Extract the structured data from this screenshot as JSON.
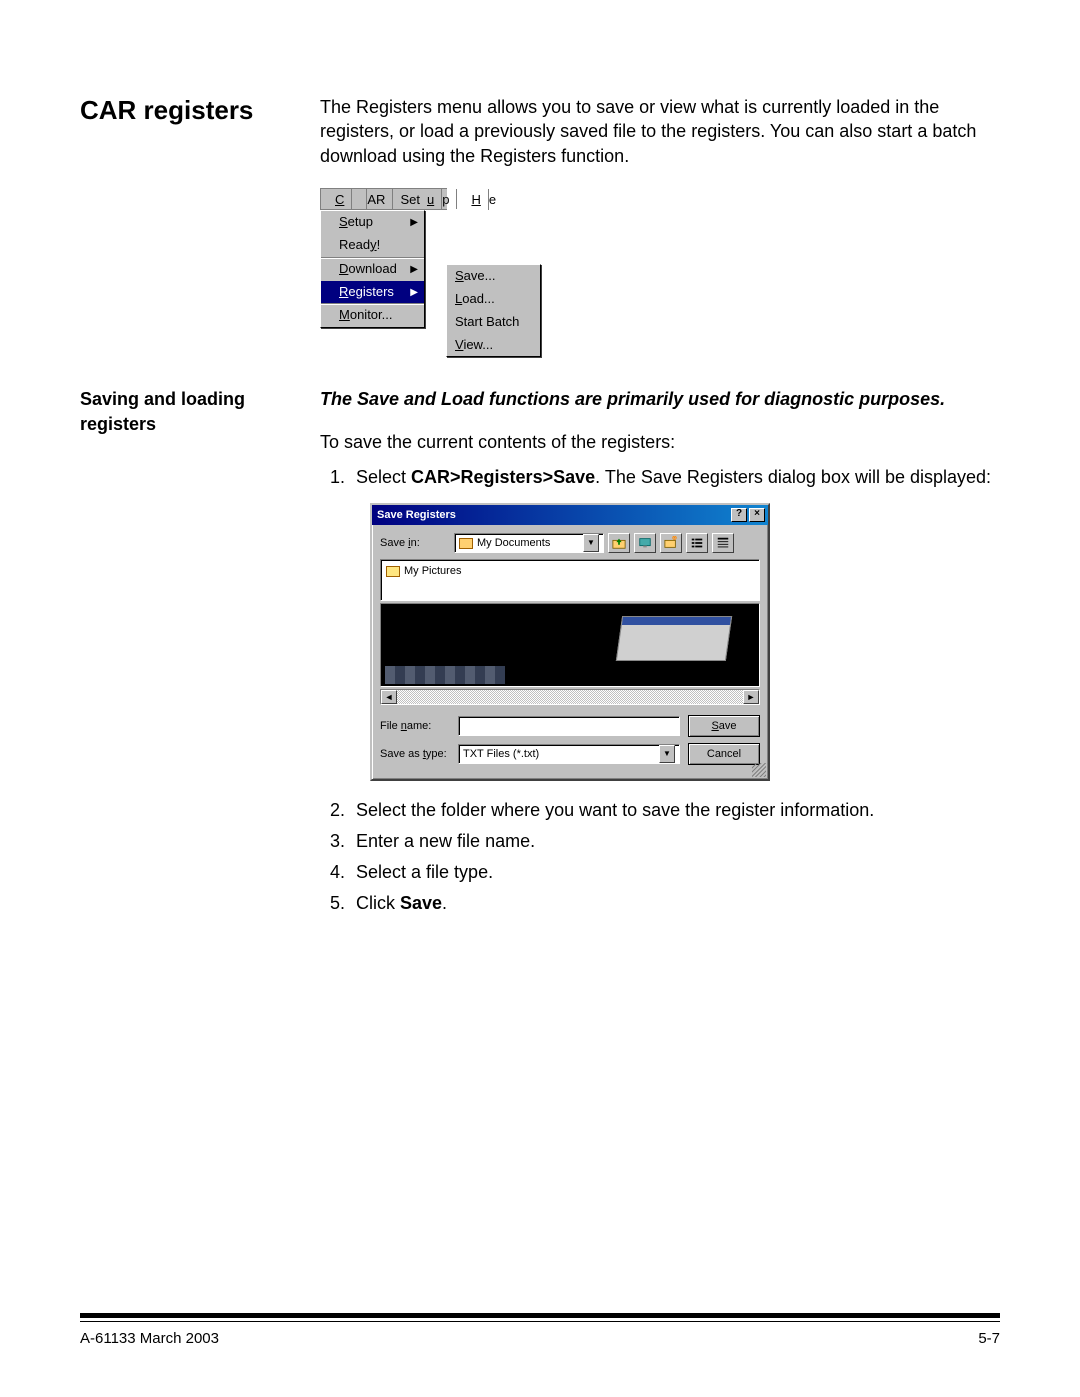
{
  "section_title": "CAR registers",
  "intro_text": "The Registers menu allows you to save or view what is currently loaded in the registers, or load a previously saved file to the registers. You can also start a batch download using the Registers function.",
  "menu": {
    "menubar": [
      "CAR",
      "Setup",
      "He"
    ],
    "dropdown": [
      {
        "label": "Setup",
        "arrow": true
      },
      {
        "label": "Ready!",
        "arrow": false
      },
      {
        "label": "Download",
        "arrow": true
      },
      {
        "label": "Registers",
        "arrow": true,
        "selected": true
      },
      {
        "label": "Monitor...",
        "arrow": false
      }
    ],
    "submenu": [
      "Save...",
      "Load...",
      "Start Batch",
      "View..."
    ]
  },
  "sub_heading": "Saving and loading registers",
  "italic_note": "The Save and Load functions are primarily used for diagnostic purposes.",
  "body_intro": "To save the current contents of the registers:",
  "step1_prefix": "Select ",
  "step1_bold": "CAR>Registers>Save",
  "step1_suffix": ".  The Save Registers dialog box will be displayed:",
  "dialog": {
    "title": "Save Registers",
    "save_in_label": "Save in:",
    "save_in_value": "My Documents",
    "file_list_item": "My Pictures",
    "filename_label": "File name:",
    "filename_value": "",
    "saveastype_label": "Save as type:",
    "saveastype_value": "TXT Files  (*.txt)",
    "save_btn": "Save",
    "cancel_btn": "Cancel",
    "toolbar_icons": [
      "up-folder-icon",
      "desktop-icon",
      "new-folder-icon",
      "list-view-icon",
      "details-view-icon"
    ]
  },
  "steps_rest": [
    "Select the folder where you want to save the register information.",
    "Enter a new file name.",
    "Select a file type."
  ],
  "step5_prefix": "Click ",
  "step5_bold": "Save",
  "step5_suffix": ".",
  "footer": {
    "left": "A-61133  March 2003",
    "right": "5-7"
  }
}
